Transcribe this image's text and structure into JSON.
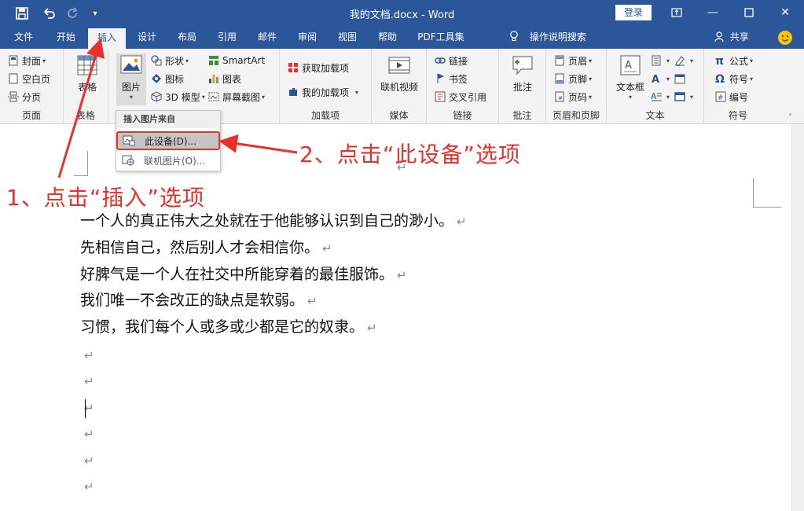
{
  "app": {
    "title": "我的文档.docx  -  Word",
    "login_label": "登录"
  },
  "tabs": [
    {
      "label": "文件"
    },
    {
      "label": "开始"
    },
    {
      "label": "插入"
    },
    {
      "label": "设计"
    },
    {
      "label": "布局"
    },
    {
      "label": "引用"
    },
    {
      "label": "邮件"
    },
    {
      "label": "审阅"
    },
    {
      "label": "视图"
    },
    {
      "label": "帮助"
    },
    {
      "label": "PDF工具集"
    }
  ],
  "tell_me": "操作说明搜索",
  "share_label": "共享",
  "ribbon": {
    "pages": {
      "label": "页面",
      "cover": "封面",
      "blank": "空白页",
      "break": "分页"
    },
    "tables": {
      "label": "表格",
      "table": "表格"
    },
    "illustrations": {
      "picture": "图片",
      "shapes": "形状",
      "icons": "图标",
      "model3d": "3D 模型",
      "smartart": "SmartArt",
      "chart": "图表",
      "screenshot": "屏幕截图"
    },
    "addins": {
      "label": "加载项",
      "get": "获取加载项",
      "mine": "我的加载项"
    },
    "media": {
      "label": "媒体",
      "online_video": "联机视频"
    },
    "links": {
      "label": "链接",
      "link": "链接",
      "bookmark": "书签",
      "crossref": "交叉引用"
    },
    "comments": {
      "label": "批注",
      "comment": "批注"
    },
    "header_footer": {
      "label": "页眉和页脚",
      "header": "页眉",
      "footer": "页脚",
      "page_number": "页码"
    },
    "text": {
      "label": "文本",
      "textbox": "文本框"
    },
    "symbols": {
      "label": "符号",
      "equation": "公式",
      "symbol": "符号",
      "number": "编号"
    }
  },
  "dropdown": {
    "header": "插入图片来自",
    "this_device": "此设备(D)...",
    "online_pictures": "联机图片(O)..."
  },
  "document": {
    "paragraphs": [
      "一个人的真正伟大之处就在于他能够认识到自己的渺小。",
      "先相信自己，然后别人才会相信你。",
      "好脾气是一个人在社交中所能穿着的最佳服饰。",
      "我们唯一不会改正的缺点是软弱。",
      "习惯，我们每个人或多或少都是它的奴隶。"
    ],
    "paragraph_mark": "↵"
  },
  "annotations": {
    "step1": "1、点击“插入”选项",
    "step2": "2、点击“此设备”选项"
  },
  "colors": {
    "title_bar": "#2b579a",
    "annotation": "#e8312a",
    "ribbon_bg": "#f3f3f3"
  }
}
